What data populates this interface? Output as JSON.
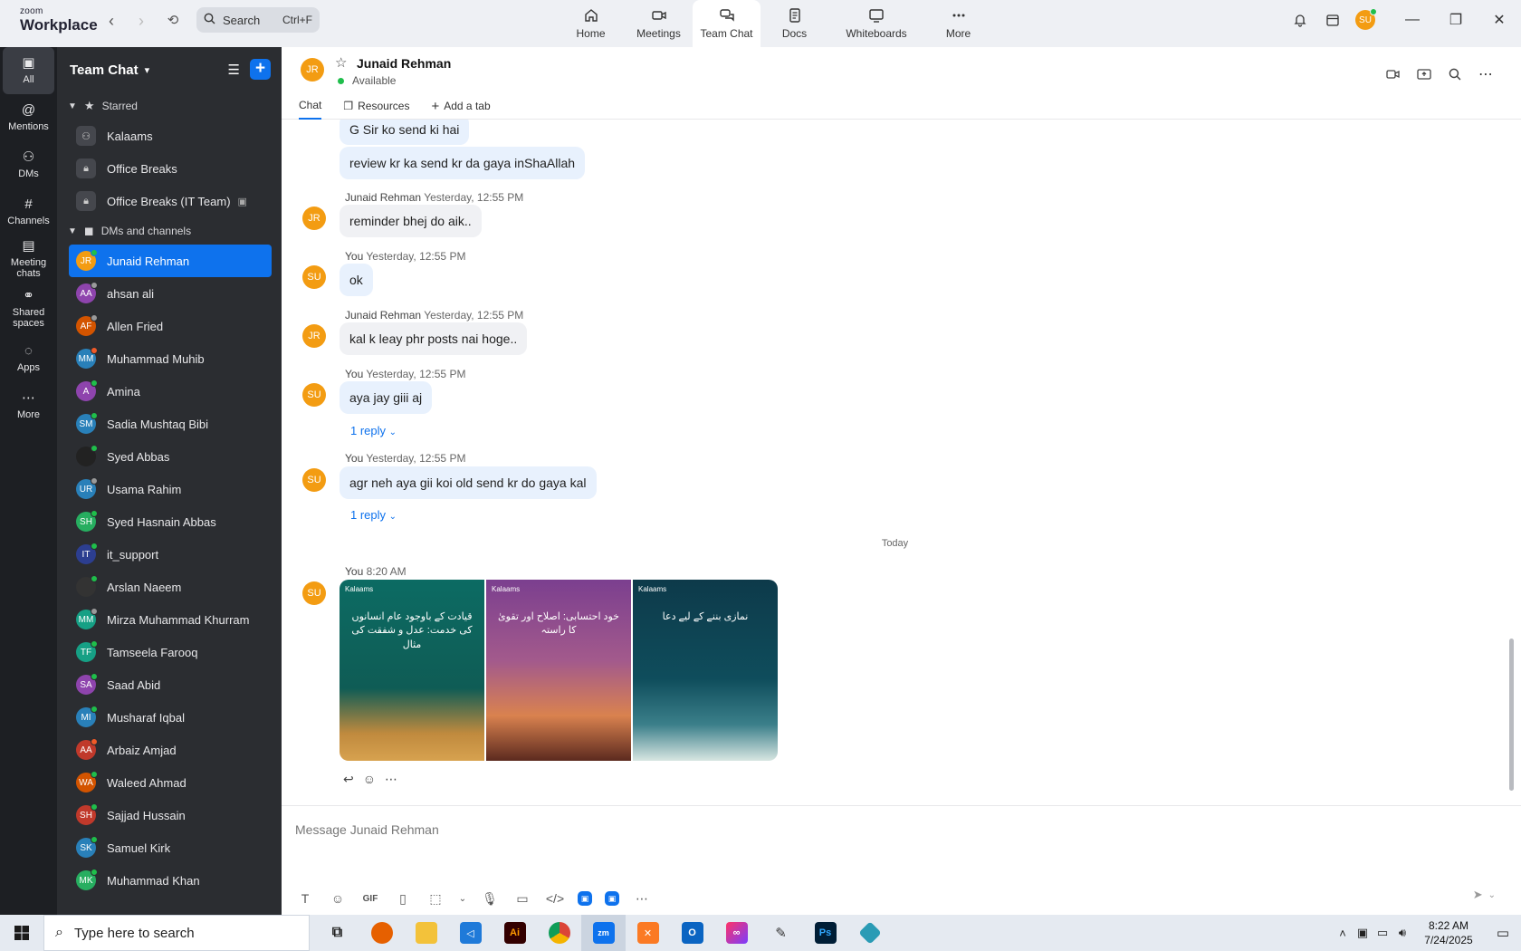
{
  "app": {
    "brand_line1": "zoom",
    "brand_line2": "Workplace",
    "search_placeholder": "Search",
    "search_shortcut": "Ctrl+F"
  },
  "main_tabs": [
    {
      "label": "Home",
      "icon": "home-icon"
    },
    {
      "label": "Meetings",
      "icon": "video-icon"
    },
    {
      "label": "Team Chat",
      "icon": "chat-icon",
      "active": true
    },
    {
      "label": "Docs",
      "icon": "document-icon"
    },
    {
      "label": "Whiteboards",
      "icon": "whiteboard-icon"
    },
    {
      "label": "More",
      "icon": "more-icon"
    }
  ],
  "user_avatar": {
    "initials": "SU",
    "color": "#f39c12"
  },
  "rail": [
    {
      "label": "All",
      "active": true
    },
    {
      "label": "Mentions"
    },
    {
      "label": "DMs"
    },
    {
      "label": "Channels"
    },
    {
      "label": "Meeting\nchats"
    },
    {
      "label": "Shared\nspaces"
    },
    {
      "label": "Apps"
    },
    {
      "label": "More"
    }
  ],
  "sidebar": {
    "title": "Team Chat",
    "starred_label": "Starred",
    "starred": [
      {
        "name": "Kalaams"
      },
      {
        "name": "Office Breaks"
      },
      {
        "name": "Office Breaks (IT Team)"
      }
    ],
    "dms_label": "DMs and channels",
    "dms": [
      {
        "name": "Junaid Rehman",
        "initials": "JR",
        "color": "#f39c12",
        "status": "on",
        "active": true
      },
      {
        "name": "ahsan ali",
        "initials": "AA",
        "color": "#8e44ad",
        "status": "off"
      },
      {
        "name": "Allen Fried",
        "initials": "AF",
        "color": "#d35400",
        "status": "off"
      },
      {
        "name": "Muhammad Muhib",
        "initials": "MM",
        "color": "#2980b9",
        "status": "busy"
      },
      {
        "name": "Amina",
        "initials": "A",
        "color": "#8e44ad",
        "status": "on"
      },
      {
        "name": "Sadia Mushtaq Bibi",
        "initials": "SM",
        "color": "#2980b9",
        "status": "on"
      },
      {
        "name": "Syed Abbas",
        "initials": "",
        "color": "#222222",
        "status": "on"
      },
      {
        "name": "Usama Rahim",
        "initials": "UR",
        "color": "#2980b9",
        "status": "off"
      },
      {
        "name": "Syed Hasnain Abbas",
        "initials": "SH",
        "color": "#27ae60",
        "status": "on"
      },
      {
        "name": "it_support",
        "initials": "IT",
        "color": "#2c3e90",
        "status": "on"
      },
      {
        "name": "Arslan Naeem",
        "initials": "",
        "color": "#333333",
        "status": "on"
      },
      {
        "name": "Mirza Muhammad Khurram",
        "initials": "MM",
        "color": "#16a085",
        "status": "off"
      },
      {
        "name": "Tamseela Farooq",
        "initials": "TF",
        "color": "#16a085",
        "status": "on"
      },
      {
        "name": "Saad Abid",
        "initials": "SA",
        "color": "#8e44ad",
        "status": "on"
      },
      {
        "name": "Musharaf Iqbal",
        "initials": "MI",
        "color": "#2980b9",
        "status": "on"
      },
      {
        "name": "Arbaiz Amjad",
        "initials": "AA",
        "color": "#c0392b",
        "status": "busy"
      },
      {
        "name": "Waleed Ahmad",
        "initials": "WA",
        "color": "#d35400",
        "status": "on"
      },
      {
        "name": "Sajjad Hussain",
        "initials": "SH",
        "color": "#c0392b",
        "status": "on"
      },
      {
        "name": "Samuel Kirk",
        "initials": "SK",
        "color": "#2980b9",
        "status": "on"
      },
      {
        "name": "Muhammad Khan",
        "initials": "MK",
        "color": "#27ae60",
        "status": "on"
      }
    ]
  },
  "chat": {
    "contact": "Junaid Rehman",
    "initials": "JR",
    "status": "Available",
    "tabs": [
      "Chat",
      "Resources",
      "Add a tab"
    ]
  },
  "messages": [
    {
      "text": "G Sir ko send ki hai",
      "mine": true
    },
    {
      "text": "review kr ka send kr da gaya inShaAllah",
      "mine": true
    },
    {
      "sender": "Junaid Rehman",
      "time": "Yesterday, 12:55 PM",
      "text": "reminder bhej do aik..",
      "initials": "JR",
      "mine": false
    },
    {
      "sender": "You",
      "time": "Yesterday, 12:55 PM",
      "text": "ok",
      "initials": "SU",
      "mine": true
    },
    {
      "sender": "Junaid Rehman",
      "time": "Yesterday, 12:55 PM",
      "text": "kal k leay phr posts nai hoge..",
      "initials": "JR",
      "mine": false
    },
    {
      "sender": "You",
      "time": "Yesterday, 12:55 PM",
      "text": "aya jay giii aj",
      "initials": "SU",
      "mine": true,
      "reply": "1 reply"
    },
    {
      "sender": "You",
      "time": "Yesterday, 12:55 PM",
      "text": "agr neh aya gii koi old send kr do gaya kal",
      "initials": "SU",
      "mine": true,
      "reply": "1 reply"
    }
  ],
  "day_separator": "Today",
  "image_message": {
    "sender": "You",
    "time": "8:20 AM",
    "initials": "SU",
    "cards": [
      {
        "logo": "Kalaams",
        "text": "قیادت کے باوجود عام انسانوں کی خدمت: عدل و شفقت کی مثال"
      },
      {
        "logo": "Kalaams",
        "text": "خود احتسابی: اصلاح اور تقویٰ کا راستہ"
      },
      {
        "logo": "Kalaams",
        "text": "نمازی بننے کے لیے دعا"
      }
    ]
  },
  "composer": {
    "placeholder": "Message Junaid Rehman"
  },
  "taskbar": {
    "search_placeholder": "Type here to search",
    "time": "8:22 AM",
    "date": "7/24/2025"
  },
  "colors": {
    "accent": "#0e72ed",
    "bubble_mine": "#e8f1fd",
    "bubble_theirs": "#f0f1f4",
    "sidebar_bg": "#2b2d31",
    "rail_bg": "#1d1f23"
  }
}
